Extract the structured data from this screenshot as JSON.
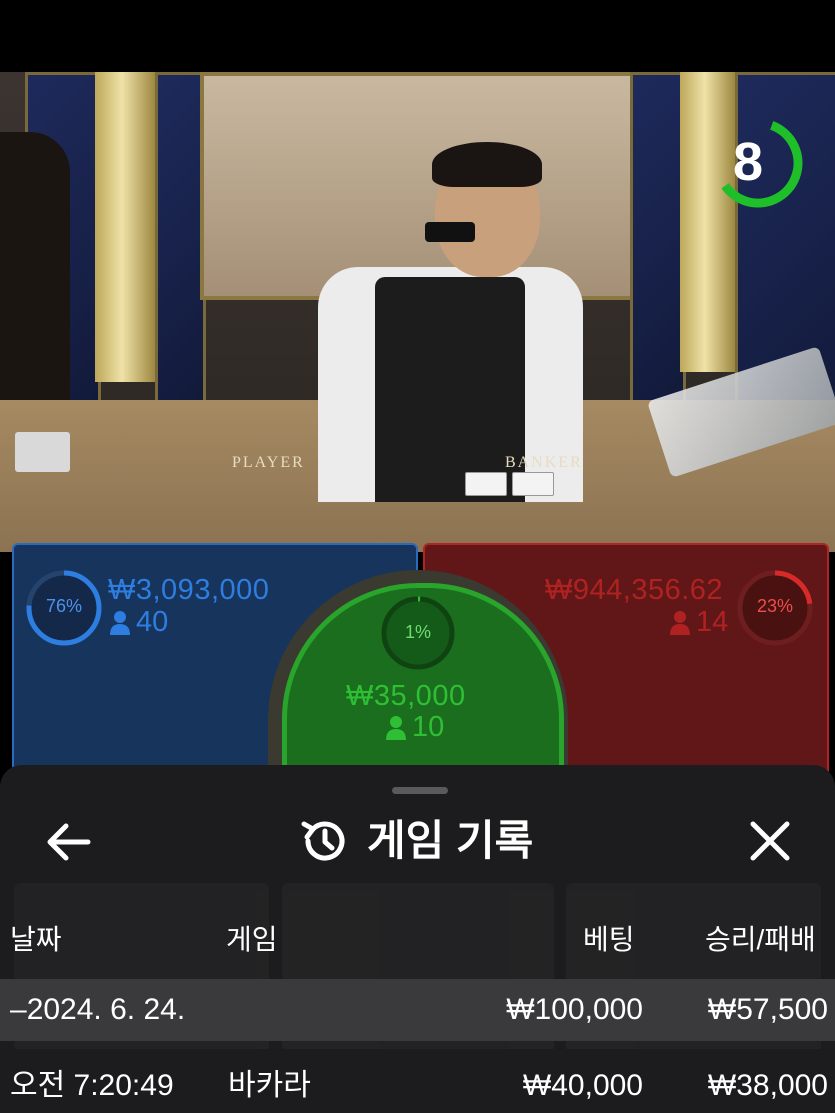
{
  "timer": {
    "value": "8",
    "color": "#1fbf2a"
  },
  "table_labels": {
    "player": "PLAYER",
    "banker": "BANKER"
  },
  "player_bet": {
    "percent": "76%",
    "percent_value": 76,
    "amount": "₩3,093,000",
    "players": "40",
    "color": "#2e7de0"
  },
  "tie_bet": {
    "percent": "1%",
    "percent_value": 1,
    "amount": "₩35,000",
    "players": "10",
    "color": "#2fbf34"
  },
  "banker_bet": {
    "percent": "23%",
    "percent_value": 23,
    "amount": "₩944,356.62",
    "players": "14",
    "color": "#d92a2a"
  },
  "sheet": {
    "title": "게임 기록",
    "back_icon": "arrow-left-icon",
    "history_icon": "history-icon",
    "close_icon": "close-icon",
    "columns": [
      "날짜",
      "게임",
      "베팅",
      "승리/패배"
    ],
    "date_group": {
      "toggle": "–",
      "date": "2024. 6. 24.",
      "bet": "₩100,000",
      "win_loss": "₩57,500"
    },
    "rows": [
      {
        "time": "오전 7:20:49",
        "game": "바카라",
        "bet": "₩40,000",
        "win_loss": "₩38,000"
      }
    ]
  }
}
